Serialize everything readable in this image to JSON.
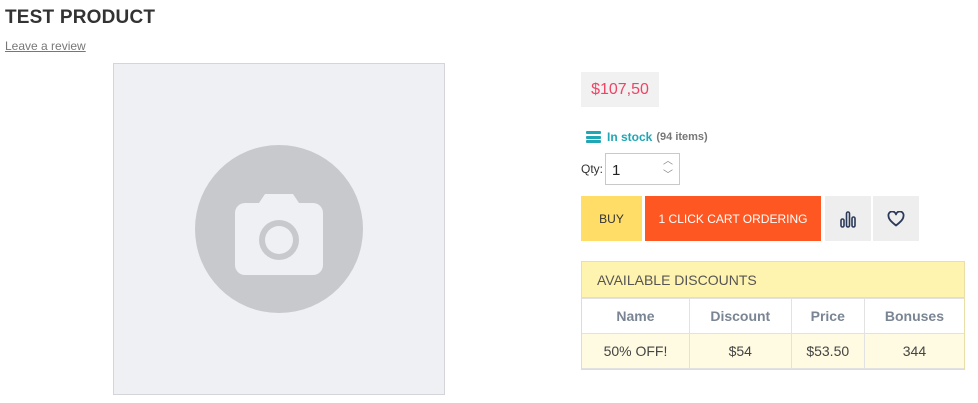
{
  "product": {
    "title": "TEST PRODUCT",
    "review_link": "Leave a review"
  },
  "price": "$107,50",
  "stock": {
    "label": "In stock",
    "count": "(94 items)"
  },
  "quantity": {
    "label": "Qty:",
    "value": "1"
  },
  "buttons": {
    "buy": "BUY",
    "one_click": "1 CLICK CART ORDERING"
  },
  "icons": {
    "placeholder": "camera-icon",
    "compare": "bar-chart-icon",
    "wishlist": "heart-icon",
    "stock": "list-icon"
  },
  "discounts": {
    "title": "AVAILABLE DISCOUNTS",
    "columns": [
      "Name",
      "Discount",
      "Price",
      "Bonuses"
    ],
    "rows": [
      [
        "50% OFF!",
        "$54",
        "$53.50",
        "344"
      ]
    ]
  },
  "colors": {
    "price": "#ee4466",
    "in_stock": "#1fa7b5",
    "buy_button": "#ffdd66",
    "one_click_button": "#ff5722",
    "discount_header": "#fff3b0"
  }
}
